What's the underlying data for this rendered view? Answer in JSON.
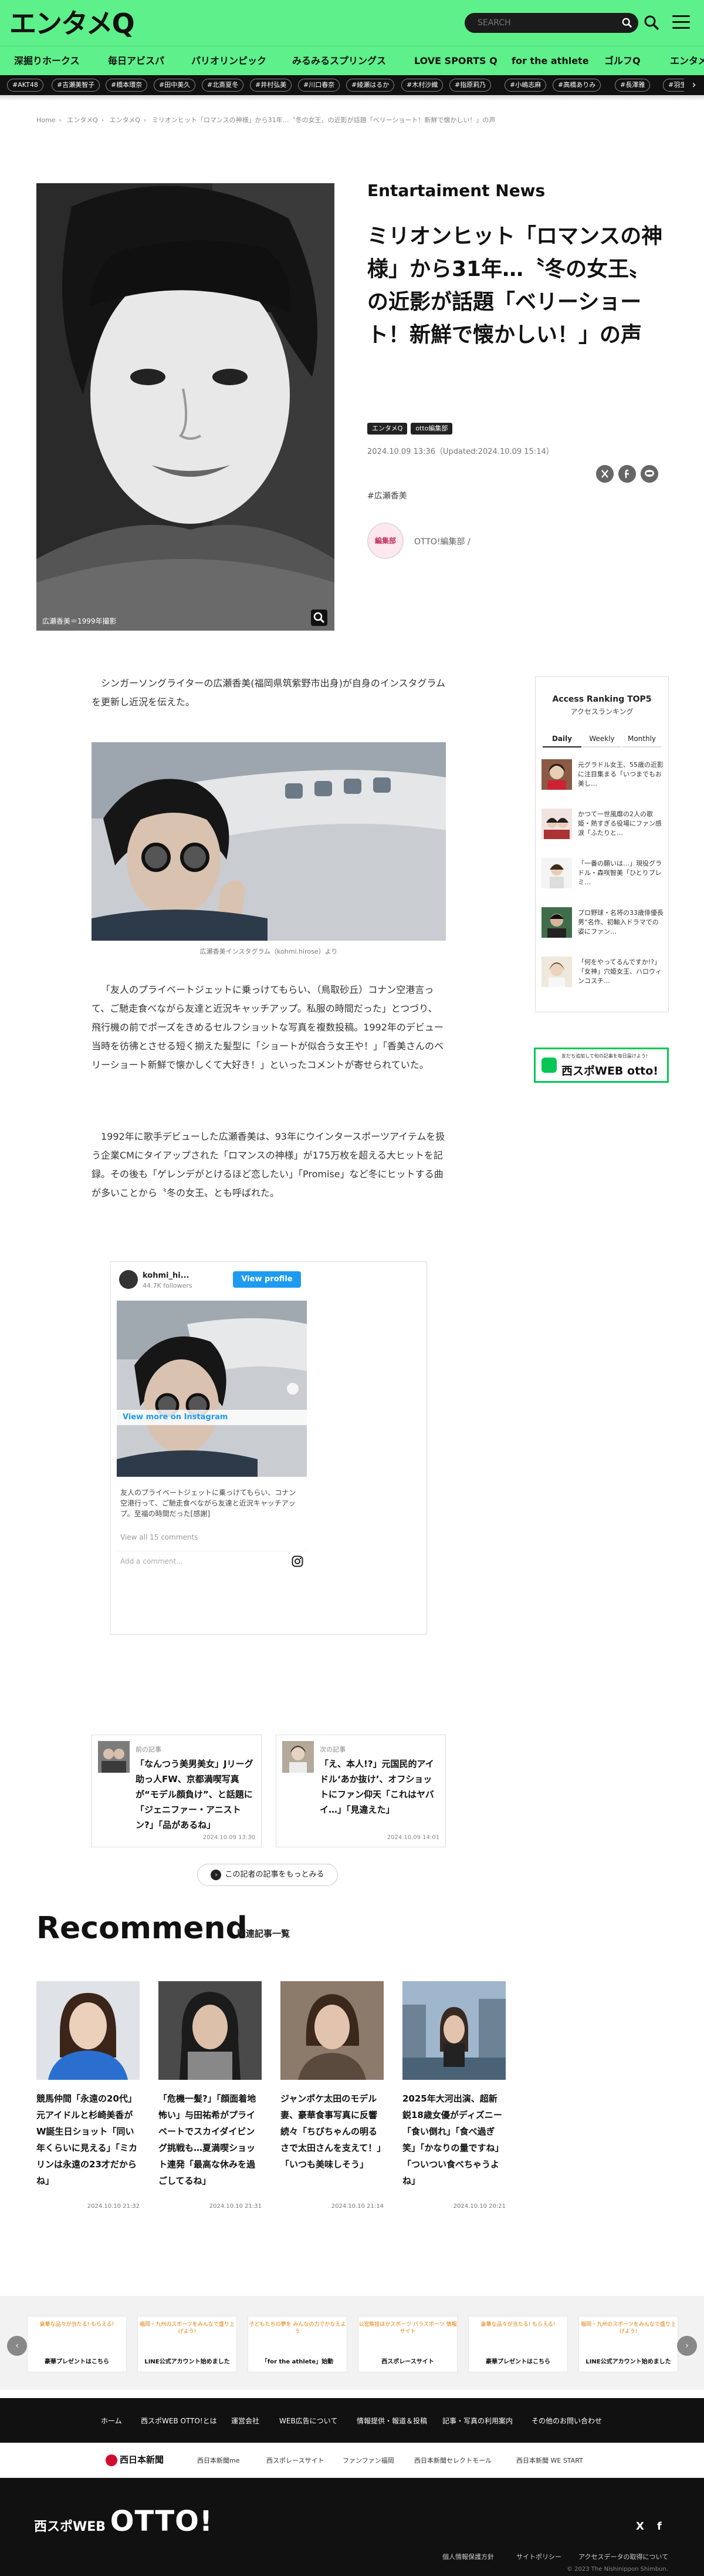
{
  "header": {
    "logo": "エンタメQ",
    "search_placeholder": "SEARCH",
    "nav": [
      "深掘りホークス",
      "毎日アビスパ",
      "パリオリンピック",
      "みるみるスプリングス",
      "LOVE SPORTS Q",
      "for the athlete",
      "ゴルフQ",
      "エンタメQ"
    ],
    "tags": [
      "#AKT48",
      "#吉瀬美智子",
      "#橋本環奈",
      "#田中美久",
      "#北斎夏冬",
      "#井村弘美",
      "#川口春奈",
      "#綾瀬はるか",
      "#木村沙織",
      "#指原莉乃",
      "#小嶋志麻",
      "#高橋ありみ",
      "#長澤雅",
      "#羽生"
    ]
  },
  "breadcrumb": [
    "Home",
    "エンタメQ",
    "エンタメQ",
    "ミリオンヒット「ロマンスの神様」から31年…〝冬の女王〟の近影が話題「ベリーショート！新鮮で懐かしい！」の声"
  ],
  "article": {
    "hero_caption": "広瀬香美＝1999年撮影",
    "category": "Entartaiment News",
    "title": "ミリオンヒット「ロマンスの神様」から31年…〝冬の女王〟の近影が話題「ベリーショート！新鮮で懐かしい！」の声",
    "badges": [
      "エンタメQ",
      "otto編集部"
    ],
    "date": "2024.10.09 13:36（Updated:2024.10.09 15:14）",
    "hashtag": "#広瀬香美",
    "author_avatar": "編集部",
    "author": "OTTO!編集部 /",
    "para1": "シンガーソングライターの広瀬香美(福岡県筑紫野市出身)が自身のインスタグラムを更新し近況を伝えた。",
    "image2_caption": "広瀬香美インスタグラム（kohmi.hirose）より",
    "para2": "「友人のプライベートジェットに乗っけてもらい、（鳥取砂丘）コナン空港言って、ご馳走食べながら友達と近況キャッチアップ。私服の時間だった」とつづり、飛行機の前でポーズをきめるセルフショットな写真を複数投稿。1992年のデビュー当時を彷彿とさせる短く揃えた髪型に「ショートが似合う女王や！」「香美さんのベリーショート新鮮で懐かしくて大好き！」といったコメントが寄せられていた。",
    "para3": "1992年に歌手デビューした広瀬香美は、93年にウインタースポーツアイテムを扱う企業CMにタイアップされた「ロマンスの神様」が175万枚を超える大ヒットを記録。その後も「ゲレンデがとけるほど恋したい」「Promise」など冬にヒットする曲が多いことから〝冬の女王〟とも呼ばれた。"
  },
  "instagram": {
    "user": "kohmi_hi...",
    "followers": "44.7K followers",
    "view_profile": "View profile",
    "view_more": "View more on Instagram",
    "caption": "友人のプライベートジェットに乗っけてもらい、コナン空港行って、ご馳走食べながら友達と近況キャッチアップ。至福の時間だった[感謝]",
    "view_all": "View all 15 comments",
    "add_comment": "Add a comment..."
  },
  "related": [
    {
      "label": "前の記事",
      "title": "「なんつう美男美女」Jリーグ助っ人FW、京都満喫写真が“モデル顔負け”、と話題に「ジェニファー・アニストン?」「品があるね」",
      "date": "2024.10.09 13:30"
    },
    {
      "label": "次の記事",
      "title": "「え、本人!?」元国民的アイドル‘あか抜け’、オフショットにファン仰天「これはヤバイ…」「見違えた」",
      "date": "2024.10.09 14:01"
    }
  ],
  "more_button": "この記者の記事をもっとみる",
  "recommend": {
    "heading": "Recommend",
    "sub": "関連記事一覧",
    "items": [
      {
        "title": "競馬仲間「永遠の20代」元アイドルと杉崎美香がW誕生日ショット「同い年くらいに見える」「ミカリンは永遠の23才だからね」",
        "date": "2024.10.10 21:32"
      },
      {
        "title": "「危機一髪?」「顔面着地怖い」与田祐希がプライベートでスカイダイビング挑戦も…夏満喫ショット連発「最高な休みを過ごしてるね」",
        "date": "2024.10.10 21:31"
      },
      {
        "title": "ジャンポケ太田のモデル妻、豪華食事写真に反響続々「ちびちゃんの明るさで太田さんを支えて！」「いつも美味しそう」",
        "date": "2024.10.10 21:14"
      },
      {
        "title": "2025年大河出演、超新鋭18歳女優がディズニー「食い倒れ」「食べ過ぎ笑」「かなりの量ですね」「ついつい食べちゃうよね」",
        "date": "2024.10.10 20:21"
      }
    ]
  },
  "ranking": {
    "title": "Access Ranking TOP5",
    "sub": "アクセスランキング",
    "tabs": [
      "Daily",
      "Weekly",
      "Monthly"
    ],
    "items": [
      "元グラドル女王、55歳の近影に注目集まる「いつまでもお美し…",
      "かつて一世風靡の2人の歌姫・熱すぎる役場にファン感涙「ふたりと…",
      "「一番の願いは…」現役グラドル・森咲智美「ひとりプレミ…",
      "プロ野球・名将の33歳俳優長男“名作、初輸入ドラマでの姿にファン…",
      "「何をやってるんですか!?」「女神」穴姫女王、ハロウィンコスチ…"
    ]
  },
  "line_banner": {
    "small": "友だち追加して旬の記事を毎日届けよう!",
    "big": "西スポWEB otto!"
  },
  "banners": [
    {
      "top": "豪華な品々が当たる!\nもらえる!",
      "bottom": "豪華プレゼントはこちら"
    },
    {
      "top": "福岡・九州のスポーツをみんなで盛り上げよう!",
      "bottom": "LINE公式アカウント始めました"
    },
    {
      "top": "子どもたちの夢を\nみんなの力でかなえよう",
      "bottom": "「for the athlete」始動"
    },
    {
      "top": "公営競技ほかスポーツ\nパラスポーツ\n情報サイト",
      "bottom": "西スポレースサイト"
    },
    {
      "top": "豪華な品々が当たる!\nもらえる!",
      "bottom": "豪華プレゼントはこちら"
    },
    {
      "top": "福岡・九州のスポーツをみんなで盛り上げよう!",
      "bottom": "LINE公式アカウント始めました"
    }
  ],
  "footer": {
    "links": [
      "ホーム",
      "西スポWEB OTTO!とは",
      "運営会社",
      "WEB広告について",
      "情報提供・報道＆投稿",
      "記事・写真の利用案内",
      "その他のお問い合わせ"
    ],
    "group": "西日本新聞",
    "group_links": [
      "西日本新聞me",
      "西スポレースサイト",
      "ファンファン福岡",
      "西日本新聞セレクトモール",
      "西日本新聞 WE START"
    ],
    "brand_small": "西スポWEB",
    "brand_big": "OTTO!",
    "social": [
      "X",
      "f"
    ],
    "fine": [
      "個人情報保護方針",
      "サイトポリシー",
      "アクセスデータの取得について"
    ],
    "copyright": "© 2023 The Nishinippon Shimbun."
  }
}
